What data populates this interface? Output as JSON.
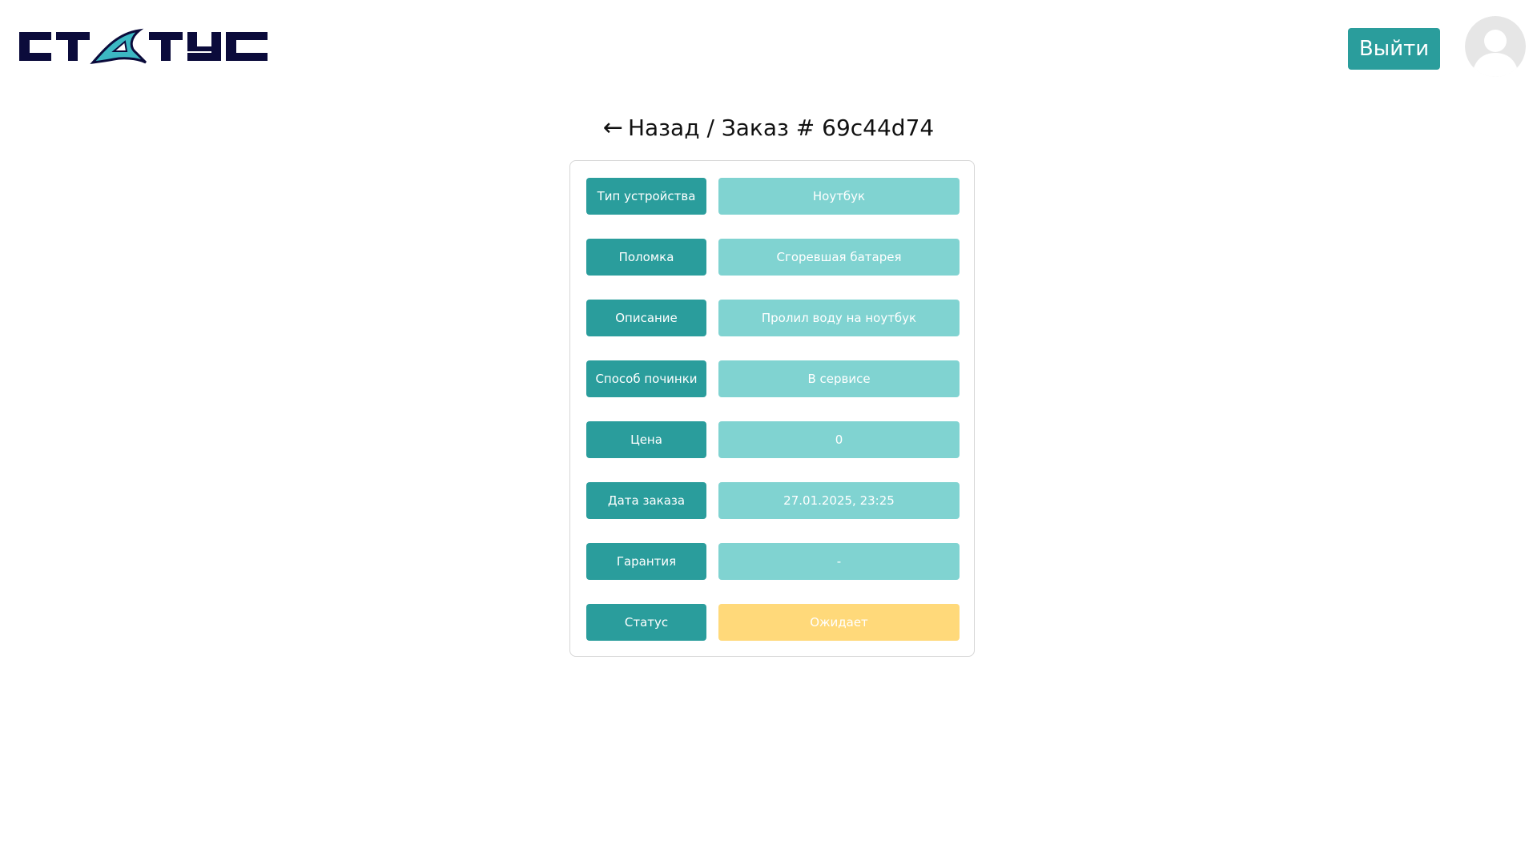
{
  "header": {
    "logo_text": "СТАТУС",
    "logout_label": "Выйти"
  },
  "breadcrumb": {
    "back_arrow": "←",
    "back_label": "Назад",
    "separator": "/",
    "order_title": "Заказ # 69c44d74"
  },
  "order": {
    "fields": [
      {
        "label": "Тип устройства",
        "value": "Ноутбук"
      },
      {
        "label": "Поломка",
        "value": "Сгоревшая батарея"
      },
      {
        "label": "Описание",
        "value": "Пролил воду на ноутбук"
      },
      {
        "label": "Способ починки",
        "value": "В сервисе"
      },
      {
        "label": "Цена",
        "value": "0"
      },
      {
        "label": "Дата заказа",
        "value": "27.01.2025, 23:25"
      },
      {
        "label": "Гарантия",
        "value": "-"
      },
      {
        "label": "Статус",
        "value": "Ожидает"
      }
    ]
  },
  "colors": {
    "accent": "#2a9d9c",
    "value_bg": "#80d3d1",
    "status_pending": "#ffd97a",
    "logo_dark": "#0b0b3b",
    "logo_teal": "#3cb8c3"
  },
  "icons": {
    "avatar": "user-avatar-icon",
    "back": "arrow-left-icon"
  }
}
